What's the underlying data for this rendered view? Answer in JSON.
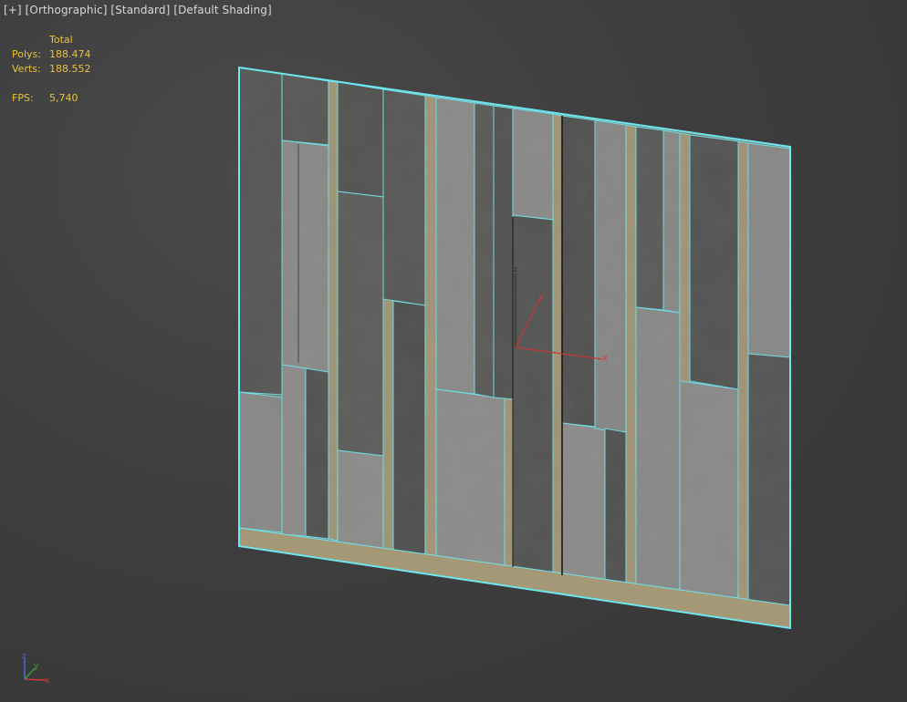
{
  "viewport": {
    "label_plus": "[+]",
    "label_view": "[Orthographic]",
    "label_mode": "[Standard]",
    "label_shading": "[Default Shading]"
  },
  "stats": {
    "header": "Total",
    "polys_label": "Polys:",
    "polys_value": "188.474",
    "verts_label": "Verts:",
    "verts_value": "188.552",
    "fps_label": "FPS:",
    "fps_value": "5,740"
  },
  "gizmo": {
    "x": "x",
    "y": "y",
    "z": "z"
  },
  "axis_tripod": {
    "x": "x",
    "y": "y",
    "z": "z"
  },
  "colors": {
    "selection": "#6ee6ee",
    "dark_panel": "#555753",
    "mid_panel": "#686866",
    "light_panel": "#8c8c8a",
    "wood": "#a59877",
    "axis_x": "#d23b3b",
    "axis_y": "#3c9c3c",
    "axis_z": "#4a6ad8"
  }
}
